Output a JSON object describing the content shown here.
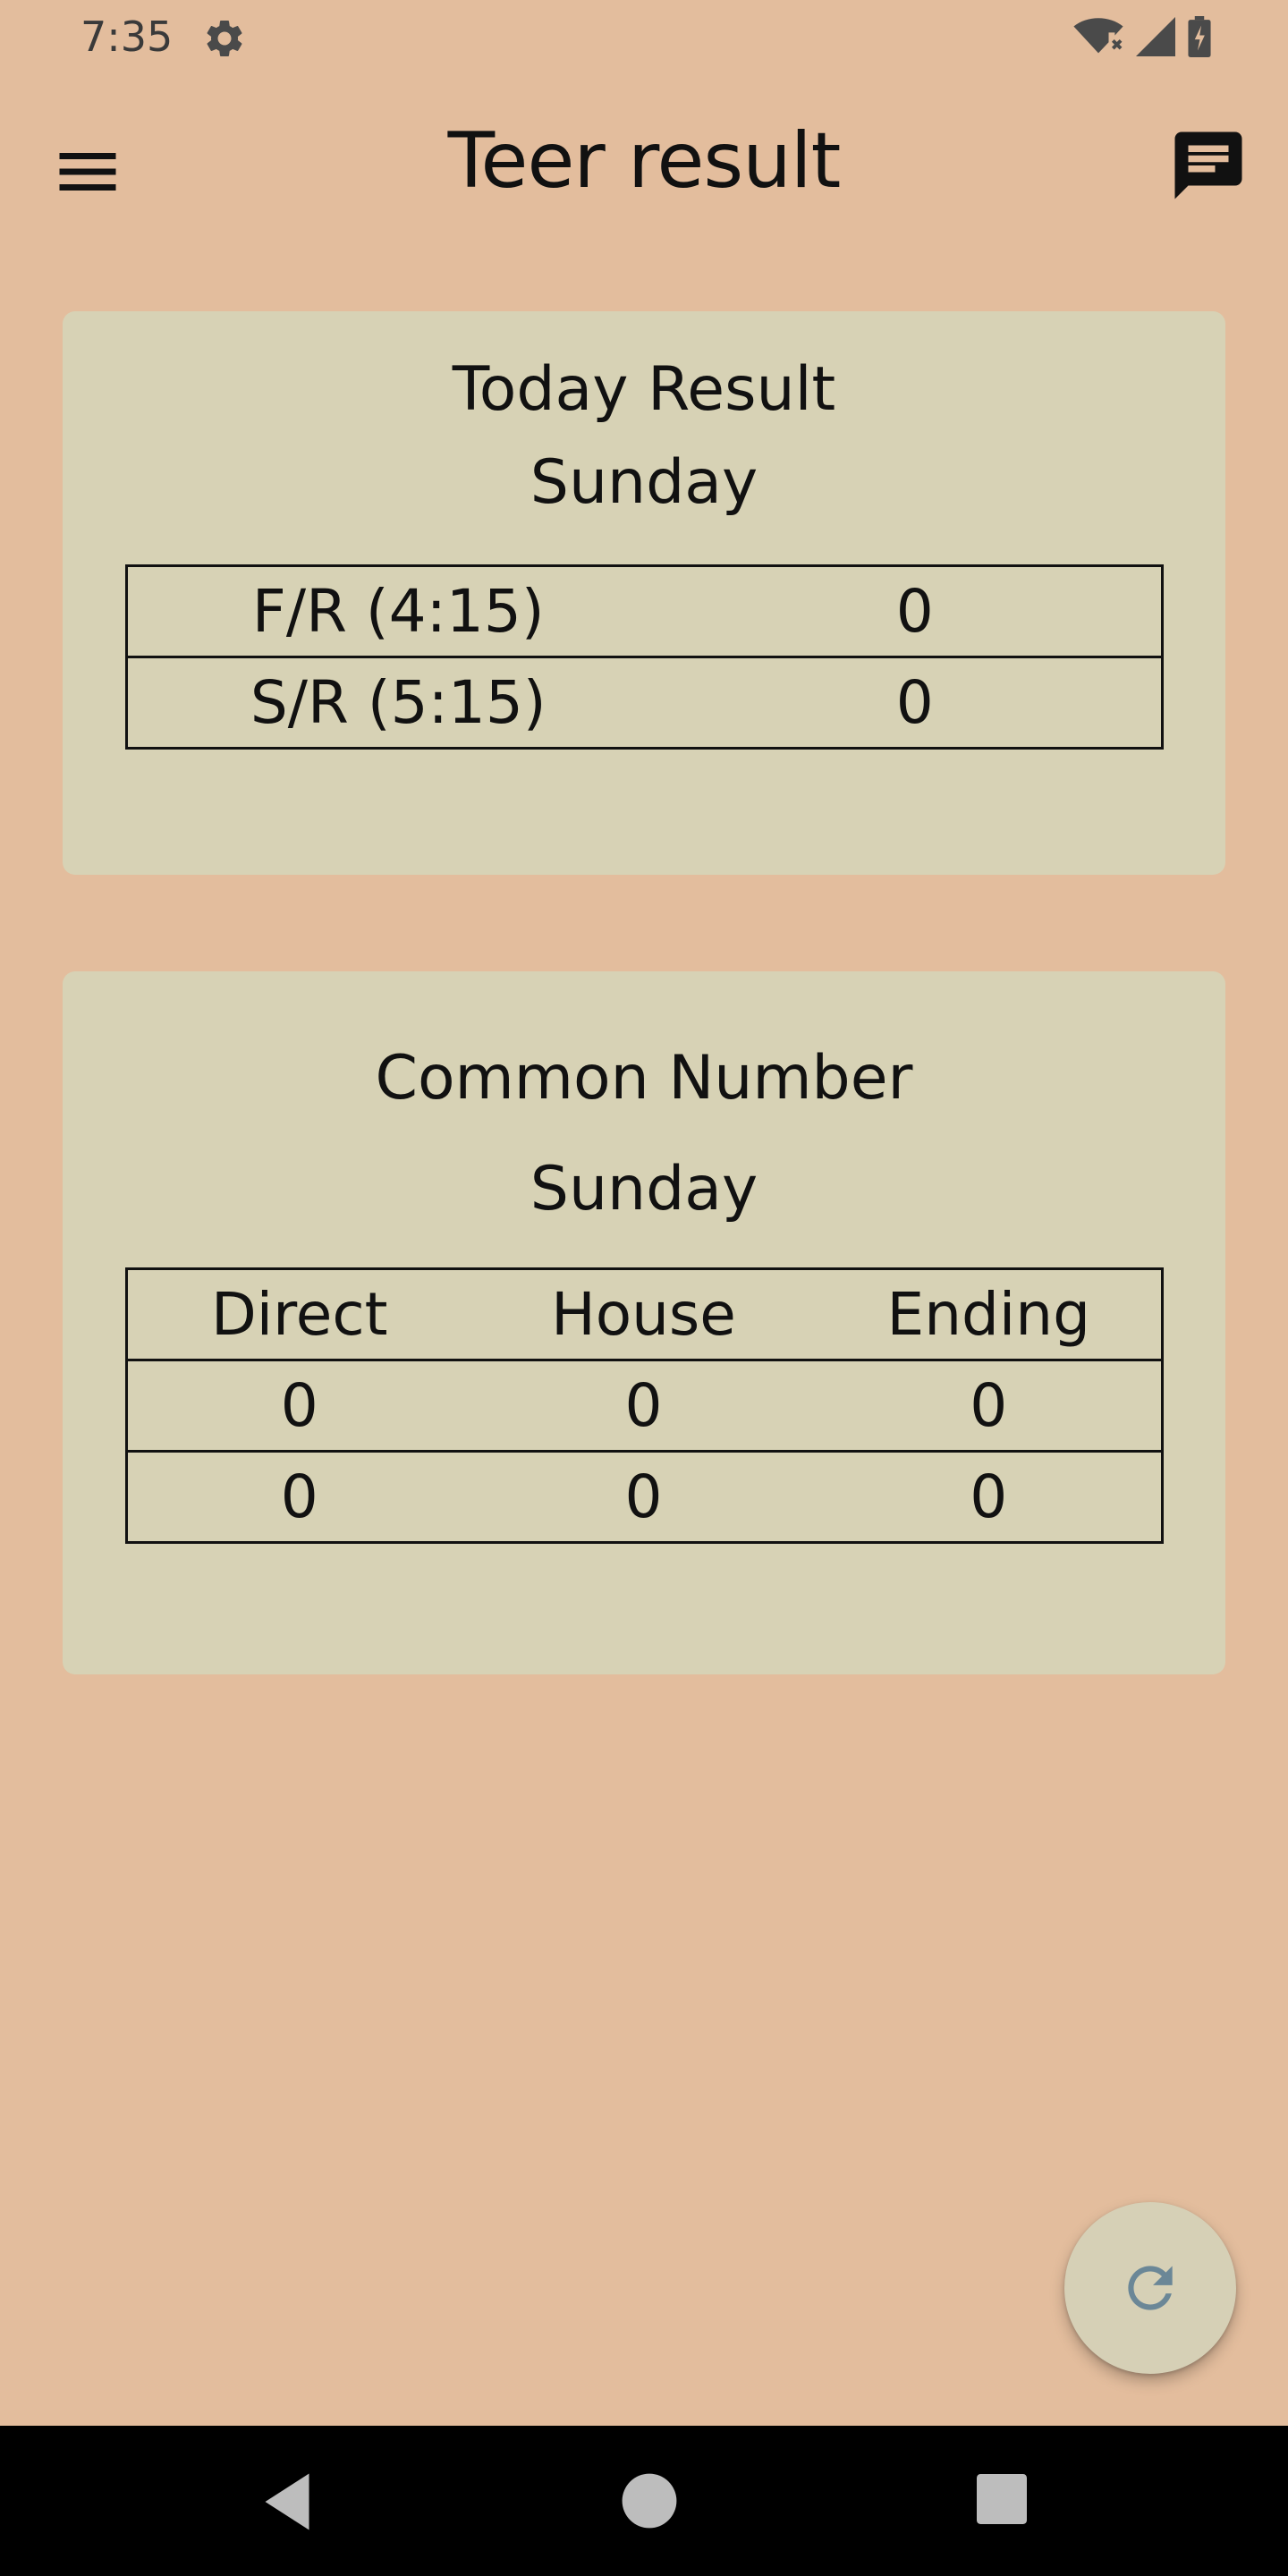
{
  "status_bar": {
    "time": "7:35",
    "icons": [
      "settings-icon",
      "wifi-off-icon",
      "signal-icon",
      "battery-charging-icon"
    ]
  },
  "app_bar": {
    "title": "Teer result",
    "left_icon": "menu-icon",
    "right_icon": "chat-icon"
  },
  "today_result": {
    "title": "Today Result",
    "day": "Sunday",
    "rows": [
      {
        "label": "F/R (4:15)",
        "value": "0"
      },
      {
        "label": "S/R (5:15)",
        "value": "0"
      }
    ]
  },
  "common_number": {
    "title": "Common Number",
    "day": "Sunday",
    "headers": [
      "Direct",
      "House",
      "Ending"
    ],
    "rows": [
      [
        "0",
        "0",
        "0"
      ],
      [
        "0",
        "0",
        "0"
      ]
    ]
  },
  "fab": {
    "icon": "refresh-icon"
  },
  "nav_bar": {
    "icons": [
      "back-icon",
      "home-icon",
      "recents-icon"
    ]
  },
  "colors": {
    "background": "#e3bd9d",
    "card": "#d7d2b5",
    "fab": "#d6d0b6",
    "fab_icon": "#6b8797",
    "nav_bar": "#000000"
  }
}
